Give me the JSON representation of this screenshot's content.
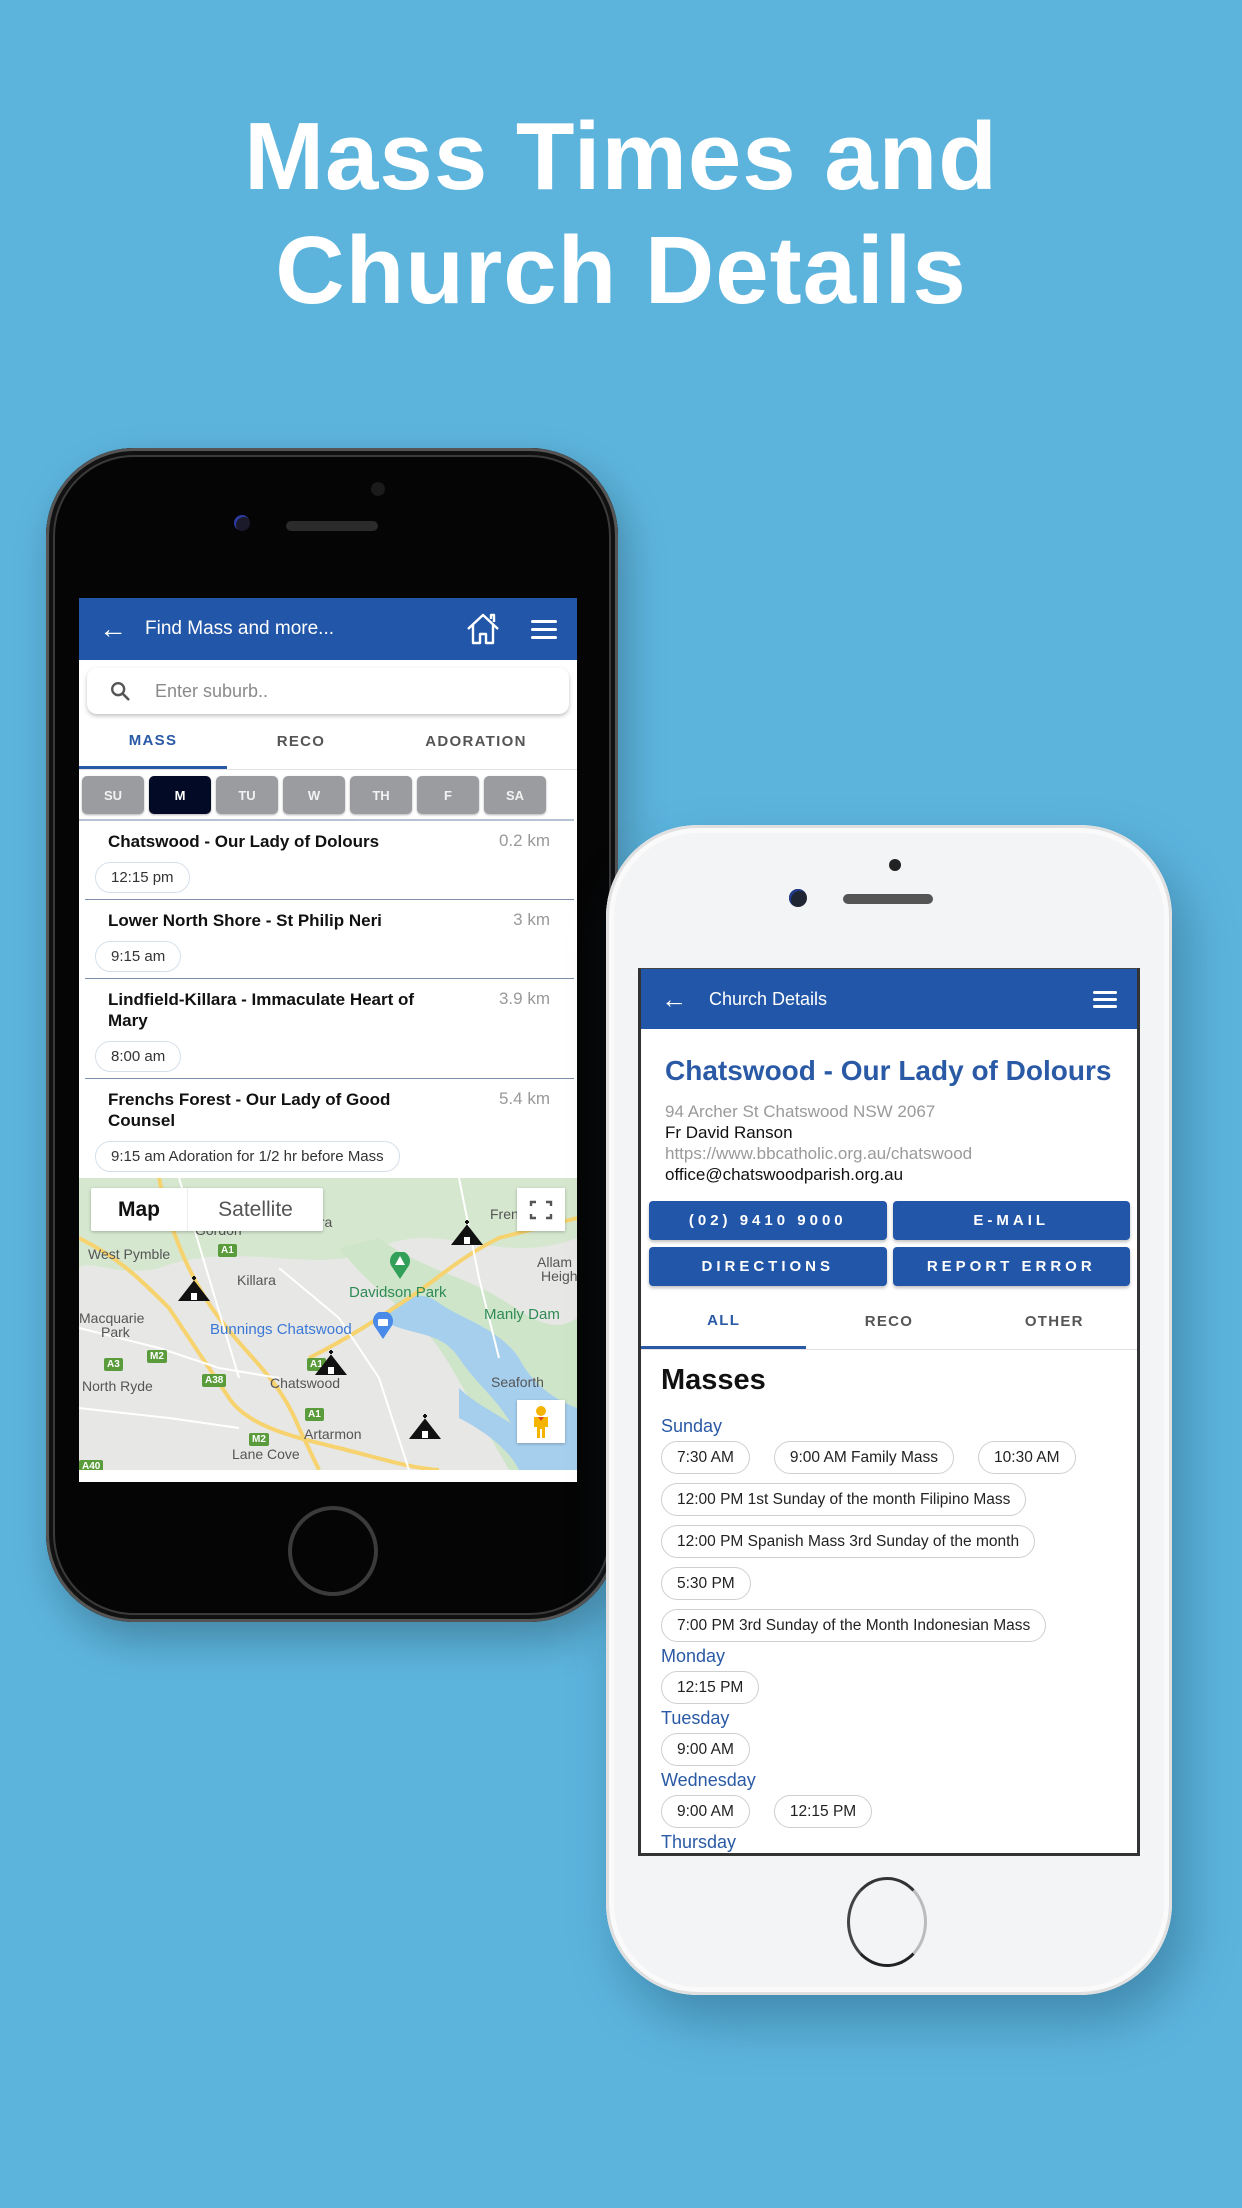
{
  "headline": {
    "line1": "Mass Times and",
    "line2": "Church Details"
  },
  "colors": {
    "background": "#5cb4dd",
    "brand_blue": "#2256a8",
    "active_day": "#020a26",
    "day_chip": "#9a9ca0"
  },
  "find_screen": {
    "appbar": {
      "back_icon": "arrow-left-icon",
      "title": "Find Mass and more...",
      "home_icon": "home-icon",
      "menu_icon": "hamburger-menu-icon"
    },
    "search": {
      "icon": "search-icon",
      "placeholder": "Enter suburb..",
      "value": ""
    },
    "tabs": [
      {
        "label": "MASS",
        "active": true
      },
      {
        "label": "RECO",
        "active": false
      },
      {
        "label": "ADORATION",
        "active": false
      }
    ],
    "days": [
      {
        "label": "SU",
        "active": false
      },
      {
        "label": "M",
        "active": true
      },
      {
        "label": "TU",
        "active": false
      },
      {
        "label": "W",
        "active": false
      },
      {
        "label": "TH",
        "active": false
      },
      {
        "label": "F",
        "active": false
      },
      {
        "label": "SA",
        "active": false
      }
    ],
    "results": [
      {
        "name": "Chatswood - Our Lady of Dolours",
        "distance": "0.2 km",
        "time": "12:15 pm"
      },
      {
        "name": "Lower North Shore - St Philip Neri",
        "distance": "3 km",
        "time": "9:15 am"
      },
      {
        "name": "Lindfield-Killara - Immaculate Heart of Mary",
        "distance": "3.9 km",
        "time": "8:00 am"
      },
      {
        "name": "Frenchs Forest - Our Lady of Good Counsel",
        "distance": "5.4 km",
        "time": "9:15 am Adoration for 1/2 hr before Mass"
      }
    ],
    "map": {
      "toggle_map": "Map",
      "toggle_satellite": "Satellite",
      "fullscreen_icon": "fullscreen-icon",
      "pegman_icon": "street-view-pegman-icon",
      "labels": {
        "gordon": "Gordon",
        "killara_top": "ara",
        "west_pymble": "West Pymble",
        "killara": "Killara",
        "davidson_park": "Davidson Park",
        "frenchs_forest": "Fren",
        "allambie": "Allam",
        "allambie2": "Heigh",
        "manly_dam": "Manly Dam",
        "macquarie": "Macquarie",
        "macquarie2": "Park",
        "bunnings": "Bunnings Chatswood",
        "north_ryde": "North Ryde",
        "chatswood": "Chatswood",
        "seaforth": "Seaforth",
        "artarmon": "Artarmon",
        "lane_cove": "Lane Cove"
      },
      "road_shields": {
        "a1_top": "A1",
        "m2_left": "M2",
        "a3": "A3",
        "a38": "A38",
        "a1_mid": "A1",
        "a1_low": "A1",
        "m2_low": "M2",
        "a40": "A40"
      }
    }
  },
  "detail_screen": {
    "appbar": {
      "back_icon": "arrow-left-icon",
      "title": "Church Details",
      "menu_icon": "hamburger-menu-icon"
    },
    "church": {
      "name": "Chatswood - Our Lady of Dolours",
      "address": "94 Archer St Chatswood NSW 2067",
      "priest": "Fr David Ranson",
      "website": "https://www.bbcatholic.org.au/chatswood",
      "email": "office@chatswoodparish.org.au"
    },
    "buttons": {
      "phone": "(02) 9410 9000",
      "email": "E-MAIL",
      "directions": "DIRECTIONS",
      "report": "REPORT ERROR"
    },
    "tabs": [
      {
        "label": "ALL",
        "active": true
      },
      {
        "label": "RECO",
        "active": false
      },
      {
        "label": "OTHER",
        "active": false
      }
    ],
    "masses_heading": "Masses",
    "schedule": [
      {
        "day": "Sunday",
        "times": [
          "7:30 AM",
          "9:00 AM Family Mass",
          "10:30 AM",
          "12:00 PM 1st Sunday of the month Filipino Mass",
          "12:00 PM Spanish Mass 3rd Sunday of the month",
          "5:30 PM",
          "7:00 PM 3rd Sunday of the Month Indonesian Mass"
        ]
      },
      {
        "day": "Monday",
        "times": [
          "12:15 PM"
        ]
      },
      {
        "day": "Tuesday",
        "times": [
          "9:00 AM"
        ]
      },
      {
        "day": "Wednesday",
        "times": [
          "9:00 AM",
          "12:15 PM"
        ]
      },
      {
        "day": "Thursday",
        "times": []
      }
    ]
  }
}
